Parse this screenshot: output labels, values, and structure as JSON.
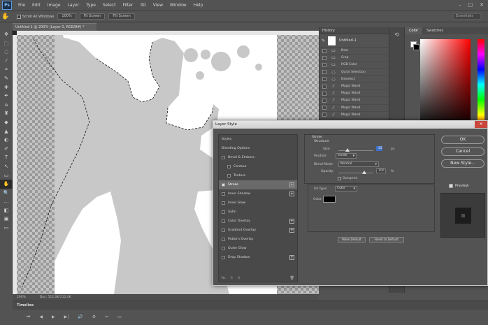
{
  "app": {
    "logo": "Ps",
    "menu": [
      "File",
      "Edit",
      "Image",
      "Layer",
      "Type",
      "Select",
      "Filter",
      "3D",
      "View",
      "Window",
      "Help"
    ],
    "window_controls": [
      "–",
      "□",
      "✕"
    ]
  },
  "options_bar": {
    "scroll_all_windows_label": "Scroll All Windows",
    "btn_100": "100%",
    "btn_fit": "Fit Screen",
    "btn_fill": "Fill Screen",
    "search_placeholder": "Essentials"
  },
  "document": {
    "tab_label": "Untitled-1 @ 200% (Layer 0, RGB/8#) *",
    "status_zoom": "200%",
    "status_doc": "Doc: 512.0K/512.0K"
  },
  "timeline": {
    "title": "Timeline",
    "controls": [
      "⏮",
      "◀",
      "▶",
      "▶|",
      "🔊",
      "⚙",
      "✂",
      "▭"
    ]
  },
  "history": {
    "title": "History",
    "snapshot_label": "Untitled-1",
    "items": [
      {
        "icon": "▭",
        "label": "New"
      },
      {
        "icon": "▭",
        "label": "Crop"
      },
      {
        "icon": "▭",
        "label": "RGB Color"
      },
      {
        "icon": "◌",
        "label": "Quick Selection"
      },
      {
        "icon": "◌",
        "label": "Deselect"
      },
      {
        "icon": "⁄",
        "label": "Magic Wand"
      },
      {
        "icon": "⁄",
        "label": "Magic Wand"
      },
      {
        "icon": "⁄",
        "label": "Magic Wand"
      },
      {
        "icon": "⁄",
        "label": "Magic Wand"
      },
      {
        "icon": "⁄",
        "label": "Magic Wand"
      }
    ]
  },
  "color_panel": {
    "tab_color": "Color",
    "tab_swatches": "Swatches",
    "fg_color": "#ffffff",
    "bg_color": "#000000"
  },
  "layer_style": {
    "title": "Layer Style",
    "styles": [
      {
        "label": "Styles",
        "checkbox": false,
        "sub": false,
        "plus": false
      },
      {
        "label": "Blending Options",
        "checkbox": false,
        "sub": false,
        "plus": false
      },
      {
        "label": "Bevel & Emboss",
        "checkbox": true,
        "checked": false,
        "sub": false,
        "plus": false
      },
      {
        "label": "Contour",
        "checkbox": true,
        "checked": false,
        "sub": true,
        "plus": false
      },
      {
        "label": "Texture",
        "checkbox": true,
        "checked": false,
        "sub": true,
        "plus": false
      },
      {
        "label": "Stroke",
        "checkbox": true,
        "checked": true,
        "sub": false,
        "plus": true,
        "selected": true
      },
      {
        "label": "Inner Shadow",
        "checkbox": true,
        "checked": false,
        "sub": false,
        "plus": true
      },
      {
        "label": "Inner Glow",
        "checkbox": true,
        "checked": false,
        "sub": false,
        "plus": false
      },
      {
        "label": "Satin",
        "checkbox": true,
        "checked": false,
        "sub": false,
        "plus": false
      },
      {
        "label": "Color Overlay",
        "checkbox": true,
        "checked": false,
        "sub": false,
        "plus": true
      },
      {
        "label": "Gradient Overlay",
        "checkbox": true,
        "checked": false,
        "sub": false,
        "plus": true
      },
      {
        "label": "Pattern Overlay",
        "checkbox": true,
        "checked": false,
        "sub": false,
        "plus": false
      },
      {
        "label": "Outer Glow",
        "checkbox": true,
        "checked": false,
        "sub": false,
        "plus": false
      },
      {
        "label": "Drop Shadow",
        "checkbox": true,
        "checked": false,
        "sub": false,
        "plus": true
      }
    ],
    "footer": {
      "fx": "fx.",
      "up": "⇧",
      "down": "⇩",
      "trash": "🗑"
    },
    "stroke": {
      "title": "Stroke",
      "subtitle": "Structure",
      "size_label": "Size:",
      "size_value": "52",
      "size_unit": "px",
      "position_label": "Position:",
      "position_value": "Inside",
      "blend_label": "Blend Mode:",
      "blend_value": "Normal",
      "opacity_label": "Opacity:",
      "opacity_value": "100",
      "opacity_unit": "%",
      "overprint_label": "Overprint"
    },
    "fill": {
      "fill_type_label": "Fill Type:",
      "fill_type_value": "Color",
      "color_label": "Color:",
      "color_value": "#000000"
    },
    "make_default": "Make Default",
    "reset_default": "Reset to Default",
    "ok": "OK",
    "cancel": "Cancel",
    "new_style": "New Style...",
    "preview_label": "Preview"
  },
  "tools": [
    "✥",
    "⬚",
    "◌",
    "⁄",
    "⌗",
    "✎",
    "✚",
    "✒",
    "⌂",
    "♜",
    "◆",
    "▲",
    "◐",
    "✐",
    "T",
    "↖",
    "▭",
    "✋",
    "🔍",
    "…",
    "◧",
    "▣",
    "▭"
  ]
}
